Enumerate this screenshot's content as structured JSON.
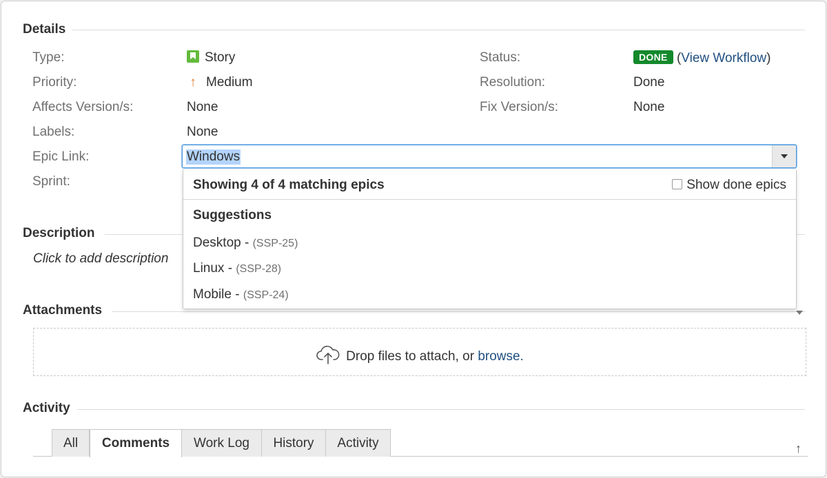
{
  "details": {
    "heading": "Details",
    "type_label": "Type:",
    "type_value": "Story",
    "priority_label": "Priority:",
    "priority_value": "Medium",
    "affects_label": "Affects Version/s:",
    "affects_value": "None",
    "labels_label": "Labels:",
    "labels_value": "None",
    "epic_label": "Epic Link:",
    "sprint_label": "Sprint:",
    "status_label": "Status:",
    "status_badge": "DONE",
    "status_open_paren": "(",
    "view_workflow": "View Workflow",
    "status_close_paren": ")",
    "resolution_label": "Resolution:",
    "resolution_value": "Done",
    "fix_label": "Fix Version/s:",
    "fix_value": "None"
  },
  "epic_input": {
    "value": "Windows"
  },
  "dropdown": {
    "header": "Showing 4 of 4 matching epics",
    "show_done_label": "Show done epics",
    "group_label": "Suggestions",
    "items": [
      {
        "name": "Desktop - ",
        "key": "(SSP-25)"
      },
      {
        "name": "Linux - ",
        "key": "(SSP-28)"
      },
      {
        "name": "Mobile - ",
        "key": "(SSP-24)"
      }
    ]
  },
  "description": {
    "heading": "Description",
    "placeholder": "Click to add description"
  },
  "attachments": {
    "heading": "Attachments",
    "drop_text": "Drop files to attach, or ",
    "browse_link": "browse."
  },
  "activity": {
    "heading": "Activity",
    "tabs": [
      "All",
      "Comments",
      "Work Log",
      "History",
      "Activity"
    ],
    "active_tab": "Comments"
  },
  "icons": {
    "story": "story-icon",
    "priority": "arrow-up-icon",
    "upload": "cloud-upload-icon",
    "scroll_top": "arrow-up-icon"
  },
  "colors": {
    "done_lozenge": "#14892c",
    "link": "#205081",
    "story_icon": "#63ba3c",
    "priority_medium": "#e07a2b"
  }
}
